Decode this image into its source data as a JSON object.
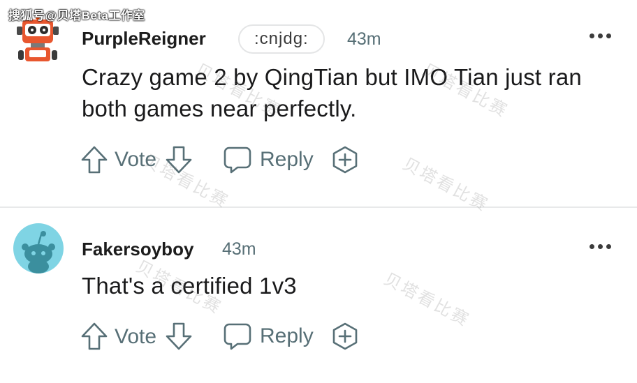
{
  "source_tag": "搜狐号@贝塔Beta工作室",
  "watermark_text": "贝塔看比赛",
  "comments": [
    {
      "username": "PurpleReigner",
      "flair": ":cnjdg:",
      "timestamp": "43m",
      "body": "Crazy game 2 by QingTian but IMO Tian just ran both games near perfectly.",
      "avatar": "robot-avatar-icon"
    },
    {
      "username": "Fakersoyboy",
      "timestamp": "43m",
      "body": "That's a certified 1v3",
      "avatar": "default-snoo-avatar-icon"
    }
  ],
  "actions": {
    "vote_label": "Vote",
    "reply_label": "Reply"
  },
  "colors": {
    "meta_gray": "#576f76",
    "divider": "#e8e9ea",
    "snoo_bg": "#7fd4e4"
  }
}
